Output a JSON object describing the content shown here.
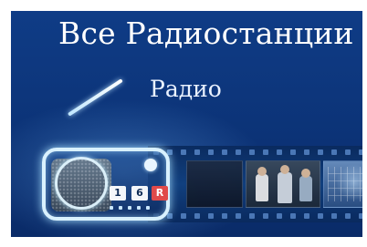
{
  "tile": {
    "title": "Все Радиостанции",
    "subtitle": "Радио"
  },
  "radio_icon": {
    "preset_keys": [
      "1",
      "6",
      "R"
    ]
  }
}
